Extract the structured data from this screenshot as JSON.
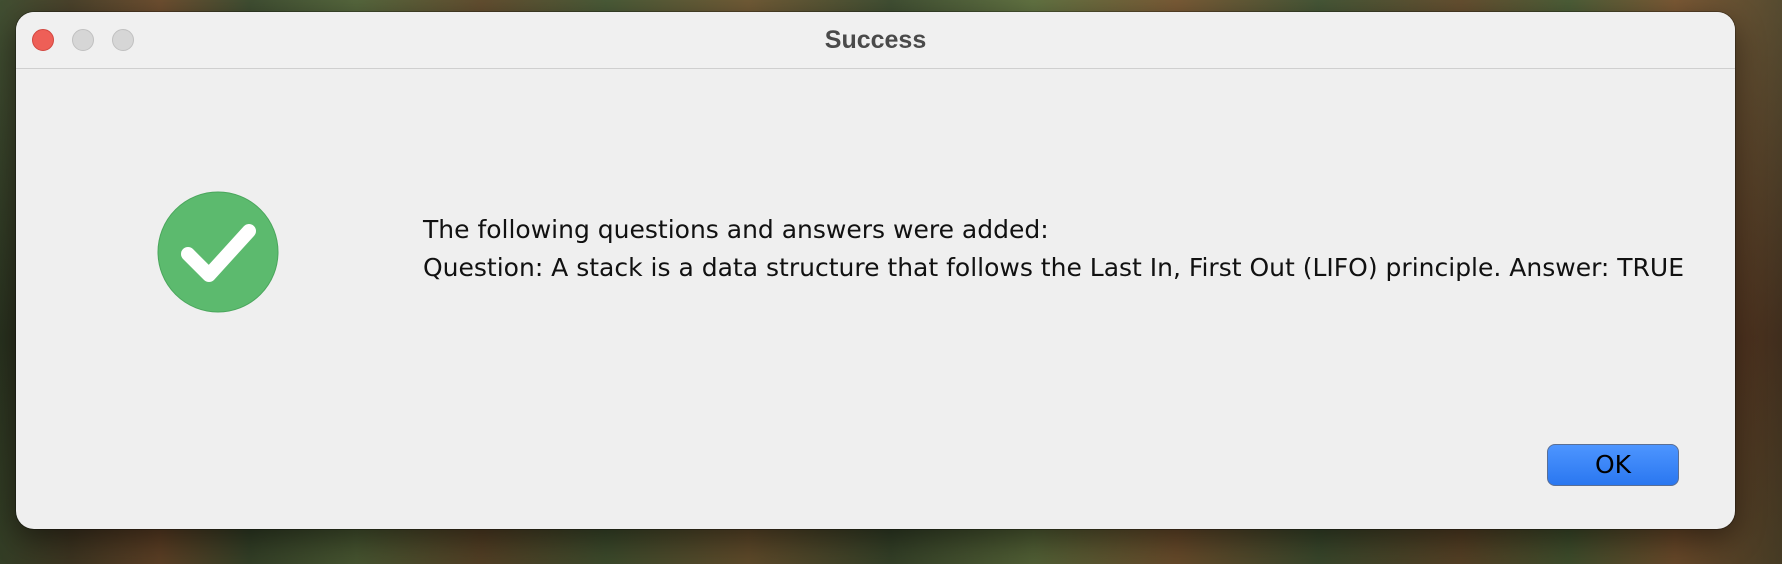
{
  "dialog": {
    "title": "Success",
    "icon": "checkmark-circle-icon",
    "message_lines": [
      "The following questions and answers were added:",
      "Question: A stack is a data structure that follows the Last In, First Out (LIFO) principle. Answer: TRUE"
    ],
    "ok_label": "OK"
  },
  "colors": {
    "close_button": "#ee5f57",
    "success_green": "#5cba6e",
    "ok_button": "#2f7df6"
  }
}
